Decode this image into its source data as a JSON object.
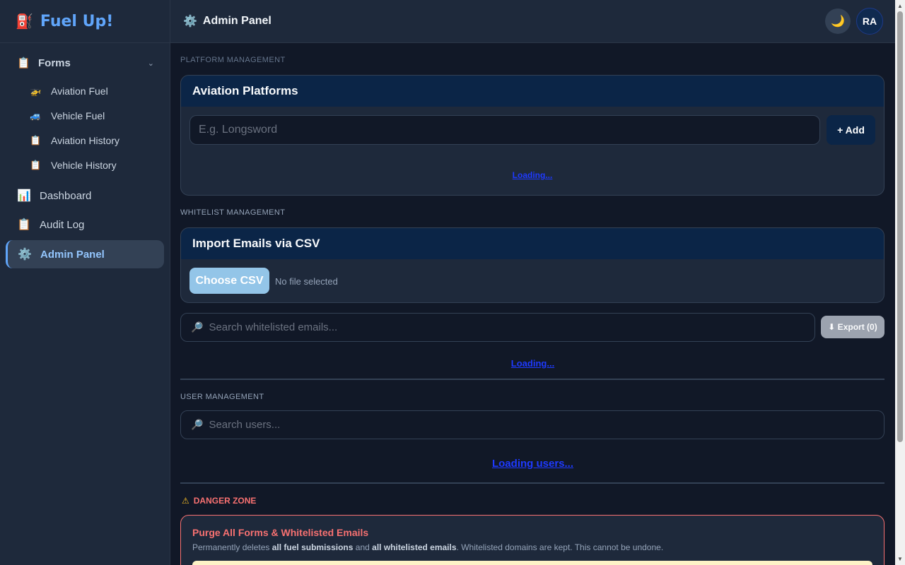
{
  "app": {
    "brand_icon": "⛽",
    "brand_name": "Fuel Up!",
    "accent_color": "#60a5fa"
  },
  "sidebar": {
    "forms": {
      "icon": "📋",
      "label": "Forms",
      "chevron": "⌄"
    },
    "sub_items": [
      {
        "icon": "🚁",
        "label": "Aviation Fuel"
      },
      {
        "icon": "🚙",
        "label": "Vehicle Fuel"
      },
      {
        "icon": "📋",
        "label": "Aviation History"
      },
      {
        "icon": "📋",
        "label": "Vehicle History"
      }
    ],
    "items": [
      {
        "icon": "📊",
        "label": "Dashboard"
      },
      {
        "icon": "📋",
        "label": "Audit Log"
      },
      {
        "icon": "⚙️",
        "label": "Admin Panel",
        "active": true
      }
    ]
  },
  "topbar": {
    "icon": "⚙️",
    "title": "Admin Panel",
    "theme_icon": "🌙",
    "avatar_initials": "RA"
  },
  "platform": {
    "section_label": "PLATFORM MANAGEMENT",
    "card_title": "Aviation Platforms",
    "input_placeholder": "E.g. Longsword",
    "add_label": "+ Add",
    "loading": "Loading..."
  },
  "whitelist": {
    "section_label": "WHITELIST MANAGEMENT",
    "card_title": "Import Emails via CSV",
    "choose_label": "Choose CSV",
    "no_file": "No file selected",
    "search_icon": "🔎",
    "search_placeholder": "Search whitelisted emails...",
    "export_label": "⬇ Export (0)",
    "loading": "Loading..."
  },
  "users": {
    "section_label": "USER MANAGEMENT",
    "search_icon": "🔎",
    "search_placeholder": "Search users...",
    "loading": "Loading users..."
  },
  "danger": {
    "icon": "⚠",
    "label": "DANGER ZONE",
    "title": "Purge All Forms & Whitelisted Emails",
    "desc_1": "Permanently deletes ",
    "desc_b1": "all fuel submissions",
    "desc_2": " and ",
    "desc_b2": "all whitelisted emails",
    "desc_3": ". Whitelisted domains are kept. This cannot be undone."
  }
}
